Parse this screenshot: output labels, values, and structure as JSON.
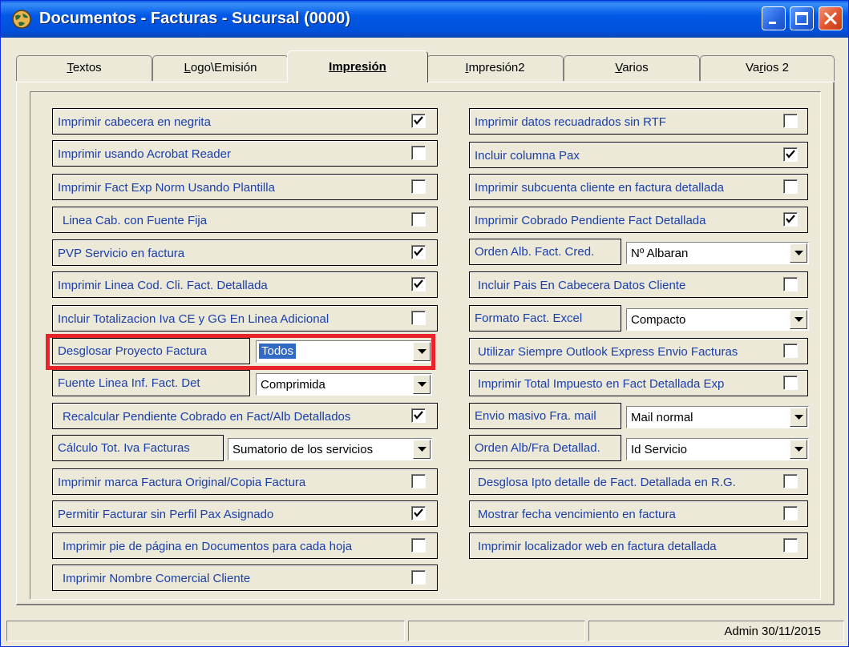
{
  "window": {
    "title": "Documentos - Facturas - Sucursal (0000)"
  },
  "tabs": [
    {
      "label": "Textos",
      "u": "T",
      "rest": "extos"
    },
    {
      "label": "Logo\\Emisión",
      "u": "L",
      "rest": "ogo\\Emisión"
    },
    {
      "label": "Impresión"
    },
    {
      "label": "Impresión2",
      "u": "I",
      "rest": "mpresión2"
    },
    {
      "label": "Varios",
      "u": "V",
      "rest": "arios"
    },
    {
      "label": "Varios 2",
      "pre": "Va",
      "u": "r",
      "rest": "ios 2"
    }
  ],
  "left": {
    "cab_negrita": {
      "label": "Imprimir cabecera en negrita",
      "checked": true
    },
    "acrobat": {
      "label": "Imprimir usando Acrobat Reader",
      "checked": false
    },
    "fact_exp_norm": {
      "label": "Imprimir Fact Exp Norm Usando Plantilla",
      "checked": false
    },
    "linea_cab_fija": {
      "label": "Linea Cab. con Fuente Fija",
      "checked": false
    },
    "pvp_servicio": {
      "label": "PVP Servicio en factura",
      "checked": true
    },
    "linea_cod_cli": {
      "label": "Imprimir Linea Cod. Cli. Fact. Detallada",
      "checked": true
    },
    "totalizacion_iva": {
      "label": "Incluir Totalizacion Iva CE y GG En Linea Adicional",
      "checked": false
    },
    "desglosar_proyecto": {
      "label": "Desglosar Proyecto Factura",
      "value": "Todos"
    },
    "fuente_linea": {
      "label": "Fuente Linea Inf. Fact. Det",
      "value": "Comprimida"
    },
    "recalcular": {
      "label": "Recalcular Pendiente Cobrado en Fact/Alb Detallados",
      "checked": true
    },
    "calculo_iva": {
      "label": "Cálculo Tot. Iva Facturas",
      "value": "Sumatorio de los servicios"
    },
    "marca_original": {
      "label": "Imprimir marca Factura Original/Copia Factura",
      "checked": false
    },
    "sin_perfil": {
      "label": "Permitir Facturar sin Perfil Pax Asignado",
      "checked": true
    },
    "pie_pagina": {
      "label": "Imprimir pie de página en Documentos para cada hoja",
      "checked": false
    },
    "nombre_comercial": {
      "label": "Imprimir Nombre Comercial Cliente",
      "checked": false
    }
  },
  "right": {
    "sin_rtf": {
      "label": "Imprimir datos recuadrados sin RTF",
      "checked": false
    },
    "columna_pax": {
      "label": "Incluir columna Pax",
      "checked": true
    },
    "subcuenta": {
      "label": "Imprimir subcuenta cliente en factura detallada",
      "checked": false
    },
    "cobrado_pendiente": {
      "label": "Imprimir Cobrado Pendiente Fact Detallada",
      "checked": true
    },
    "orden_alb": {
      "label": "Orden Alb. Fact. Cred.",
      "value": "Nº Albaran"
    },
    "pais_cabecera": {
      "label": "Incluir Pais En Cabecera Datos Cliente",
      "checked": false
    },
    "formato_excel": {
      "label": "Formato Fact. Excel",
      "value": "Compacto"
    },
    "outlook": {
      "label": "Utilizar Siempre Outlook Express Envio Facturas",
      "checked": false
    },
    "total_impuesto": {
      "label": "Imprimir Total Impuesto en Fact Detallada Exp",
      "checked": false
    },
    "envio_masivo": {
      "label": "Envio masivo Fra. mail",
      "value": "Mail normal"
    },
    "orden_fra": {
      "label": "Orden Alb/Fra Detallad.",
      "value": "Id Servicio"
    },
    "desglosa_ipto": {
      "label": "Desglosa Ipto detalle de Fact. Detallada en R.G.",
      "checked": false
    },
    "fecha_venc": {
      "label": "Mostrar fecha vencimiento en factura",
      "checked": false
    },
    "localizador": {
      "label": "Imprimir localizador web en factura detallada",
      "checked": false
    }
  },
  "status": {
    "user_date": "Admin 30/11/2015"
  }
}
